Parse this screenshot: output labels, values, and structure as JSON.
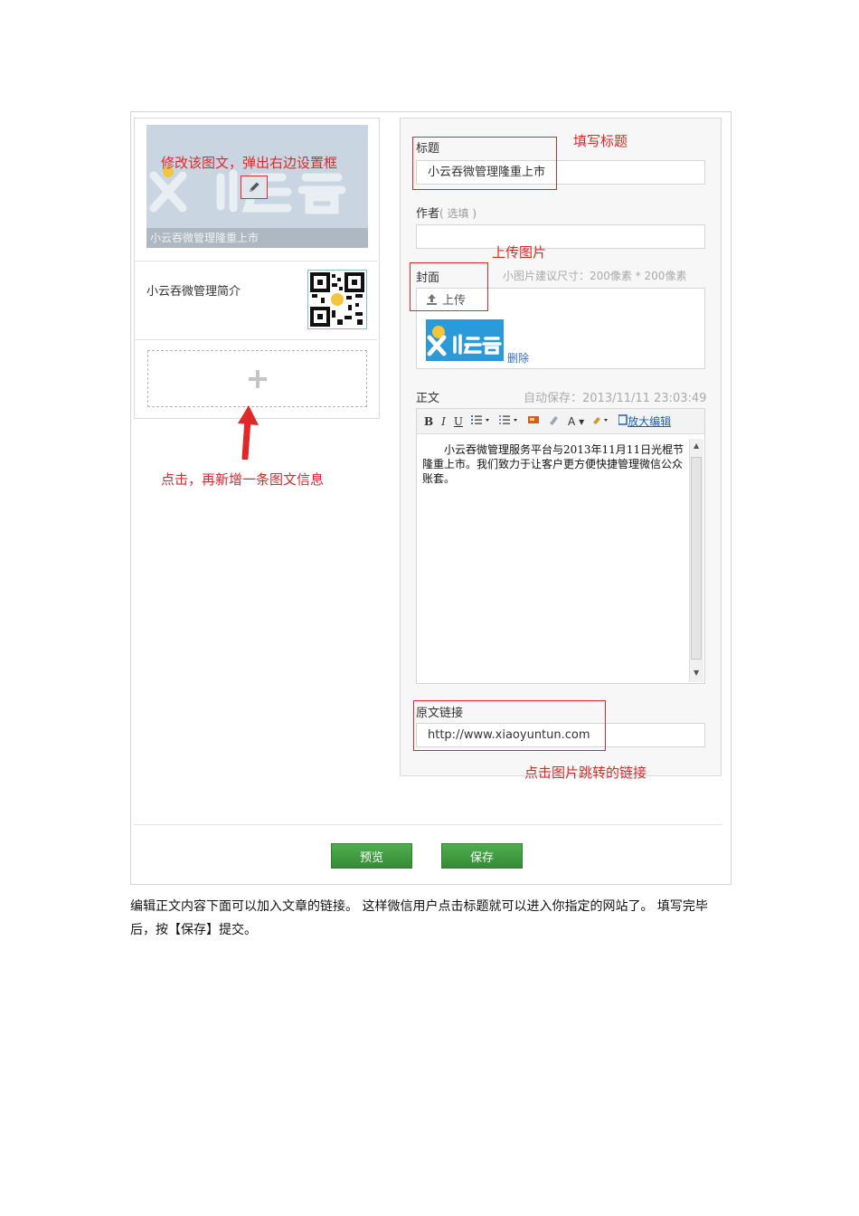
{
  "left": {
    "cover_caption": "小云吞微管理隆重上市",
    "item2_title": "小云吞微管理简介"
  },
  "annotations": {
    "edit_hint": "修改该图文，弹出右边设置框",
    "add_hint": "点击，再新增一条图文信息",
    "title_hint": "填写标题",
    "upload_hint": "上传图片",
    "link_hint": "点击图片跳转的链接"
  },
  "form": {
    "title_label": "标题",
    "title_value": "小云吞微管理隆重上市",
    "author_label": "作者",
    "author_optional": "( 选填 )",
    "cover_label": "封面",
    "cover_size_hint": "小图片建议尺寸：200像素 * 200像素",
    "upload_label": "上传",
    "delete_label": "删除",
    "body_label": "正文",
    "autosave": "自动保存：2013/11/11 23:03:49",
    "toolbar": {
      "bold": "B",
      "italic": "I",
      "underline": "U",
      "font_color": "A",
      "zoom_edit": "放大编辑"
    },
    "body_text": "小云吞微管理服务平台与2013年11月11日光棍节隆重上市。我们致力于让客户更方便快捷管理微信公众账套。",
    "link_label": "原文链接",
    "link_value": "http://www.xiaoyuntun.com"
  },
  "buttons": {
    "preview": "预览",
    "save": "保存"
  },
  "caption": "编辑正文内容下面可以加入文章的链接。 这样微信用户点击标题就可以进入你指定的网站了。 填写完毕后，按【保存】提交。",
  "colors": {
    "annotation_red": "#e02828",
    "button_green": "#3f9a3f",
    "link_blue": "#3b6fb6"
  }
}
